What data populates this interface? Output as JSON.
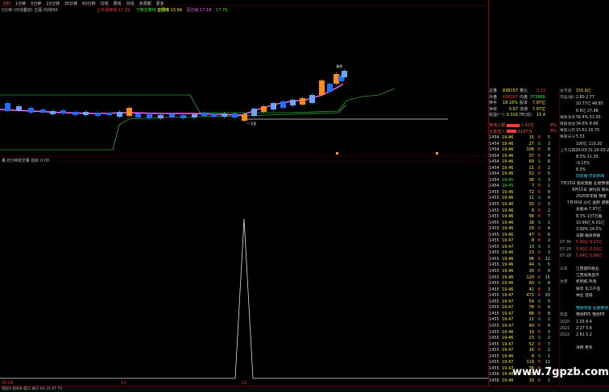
{
  "tabs": [
    "分时",
    "1分钟",
    "5分钟",
    "15分钟",
    "30分钟",
    "60分钟",
    "日线",
    "周线",
    "月线",
    "多周期",
    "更多"
  ],
  "legend_main": "5分钟 (日线叠加) 主图:均线MA",
  "legend_mid": [
    "上升涨停线 17.19",
    "下降支撑线 15.15"
  ],
  "legend_right": [
    "主要线 13.99",
    "压力线 17.18",
    "17.79"
  ],
  "sub_title": "量 8分钟成交量 指标 0.00",
  "price_labels": [
    "涨停",
    "一飞龙"
  ],
  "bottom_x_labels": [
    "01-08",
    "13",
    "12"
  ],
  "status_bar": "指标A 指标B 窗口 关口 KS 15 XT TV",
  "quote": {
    "rows": [
      {
        "l": "总量",
        "v": "838157",
        "vc": "",
        "l2": "量比",
        "v2": "2.13",
        "v2c": "red"
      },
      {
        "l": "外盘",
        "v": "436197",
        "vc": "red",
        "l2": "内盘",
        "v2": "373680",
        "v2c": "green"
      },
      {
        "l": "换手",
        "v": "18.16%",
        "vc": "",
        "l2": "股本",
        "v2": "7.97亿",
        "v2c": ""
      },
      {
        "l": "净资",
        "v": "5.67",
        "vc": "",
        "l2": "流通",
        "v2": "7.97亿",
        "v2c": ""
      },
      {
        "l": "收益(一)",
        "v": "0.316",
        "vc": "",
        "l2": "PE(动)",
        "v2": "15.4",
        "v2c": ""
      }
    ]
  },
  "flow": [
    {
      "l": "净流入额",
      "bar": 16,
      "v": "1.41亿",
      "p": "8%"
    },
    {
      "l": "大单流入",
      "bar": 12,
      "v": "6187万",
      "p": "8%"
    }
  ],
  "ticks": [
    {
      "t": "1454",
      "p": "19.46",
      "v": "15",
      "d": "B",
      "n": "5"
    },
    {
      "t": "1454",
      "p": "19.46",
      "v": "27",
      "d": "S",
      "n": "3"
    },
    {
      "t": "1454",
      "p": "19.46",
      "v": "106",
      "d": "B",
      "n": "8"
    },
    {
      "t": "1454",
      "p": "19.46",
      "v": "37",
      "d": "B",
      "n": "4"
    },
    {
      "t": "1454",
      "p": "19.46",
      "v": "69",
      "d": "S",
      "n": "6"
    },
    {
      "t": "1454",
      "p": "19.46",
      "v": "11",
      "d": "B",
      "n": "2"
    },
    {
      "t": "1454",
      "p": "19.46",
      "v": "52",
      "d": "B",
      "n": "5"
    },
    {
      "t": "1454",
      "p": "19.45",
      "v": "38",
      "d": "S",
      "n": "3"
    },
    {
      "t": "1454",
      "p": "19.45",
      "v": "7",
      "d": "B",
      "n": "1"
    },
    {
      "t": "1455",
      "p": "19.46",
      "v": "72",
      "d": "B",
      "n": "9"
    },
    {
      "t": "1455",
      "p": "19.46",
      "v": "11",
      "d": "S",
      "n": "4"
    },
    {
      "t": "1455",
      "p": "19.46",
      "v": "35",
      "d": "B",
      "n": "3"
    },
    {
      "t": "1455",
      "p": "19.46",
      "v": "6",
      "d": "B",
      "n": "2"
    },
    {
      "t": "1455",
      "p": "19.46",
      "v": "56",
      "d": "B",
      "n": "7"
    },
    {
      "t": "1455",
      "p": "19.46",
      "v": "18",
      "d": "S",
      "n": "1"
    },
    {
      "t": "1455",
      "p": "19.46",
      "v": "29",
      "d": "B",
      "n": "4"
    },
    {
      "t": "1455",
      "p": "19.46",
      "v": "47",
      "d": "B",
      "n": "6"
    },
    {
      "t": "1455",
      "p": "19.47",
      "v": "8",
      "d": "B",
      "n": "2"
    },
    {
      "t": "1455",
      "p": "19.47",
      "v": "13",
      "d": "S",
      "n": "1"
    },
    {
      "t": "1455",
      "p": "19.46",
      "v": "23",
      "d": "B",
      "n": "3"
    },
    {
      "t": "1455",
      "p": "19.46",
      "v": "96",
      "d": "B",
      "n": "12"
    },
    {
      "t": "1455",
      "p": "19.46",
      "v": "44",
      "d": "S",
      "n": "5"
    },
    {
      "t": "1455",
      "p": "19.46",
      "v": "30",
      "d": "B",
      "n": "4"
    },
    {
      "t": "1455",
      "p": "19.46",
      "v": "120",
      "d": "B",
      "n": "15"
    },
    {
      "t": "1455",
      "p": "19.46",
      "v": "60",
      "d": "S",
      "n": "6"
    },
    {
      "t": "1455",
      "p": "19.46",
      "v": "42",
      "d": "B",
      "n": "3"
    },
    {
      "t": "1455",
      "p": "19.47",
      "v": "471",
      "d": "B",
      "n": "20"
    },
    {
      "t": "1455",
      "p": "19.47",
      "v": "54",
      "d": "S",
      "n": "5"
    },
    {
      "t": "1455",
      "p": "19.47",
      "v": "78",
      "d": "B",
      "n": "6"
    },
    {
      "t": "1455",
      "p": "19.47",
      "v": "88",
      "d": "B",
      "n": "8"
    },
    {
      "t": "1455",
      "p": "19.47",
      "v": "11",
      "d": "S",
      "n": "2"
    },
    {
      "t": "1455",
      "p": "19.47",
      "v": "60",
      "d": "B",
      "n": "4"
    },
    {
      "t": "1455",
      "p": "19.46",
      "v": "19",
      "d": "B",
      "n": "3"
    },
    {
      "t": "1455",
      "p": "19.46",
      "v": "23",
      "d": "S",
      "n": "2"
    },
    {
      "t": "1455",
      "p": "19.47",
      "v": "52",
      "d": "B",
      "n": "7"
    },
    {
      "t": "1455",
      "p": "19.47",
      "v": "16",
      "d": "B",
      "n": "2"
    },
    {
      "t": "1455",
      "p": "19.46",
      "v": "8",
      "d": "S",
      "n": "1"
    },
    {
      "t": "1455",
      "p": "19.47",
      "v": "119",
      "d": "B",
      "n": "11"
    },
    {
      "t": "1455",
      "p": "19.47",
      "v": "38",
      "d": "B",
      "n": "5"
    },
    {
      "t": "1456",
      "p": "19.48",
      "v": "26",
      "d": "S",
      "n": "3"
    },
    {
      "t": "1456",
      "p": "19.48",
      "v": "10",
      "d": "B",
      "n": "2"
    }
  ],
  "ftable": [
    {
      "l": "总市值",
      "v": "155.0亿",
      "c": ""
    },
    {
      "l": "市盈(静)",
      "v": "2.80 2.77",
      "c": "w"
    },
    {
      "l": "",
      "v": "10.77亿 48.85",
      "c": "w"
    },
    {
      "l": "",
      "v": "6.6亿 27.68",
      "c": "w"
    },
    {
      "l": "每股净资",
      "v": "56.4% 51.00",
      "c": "w"
    },
    {
      "l": "每股收益",
      "v": "34.6% 8.68",
      "c": "w"
    },
    {
      "l": "每股公积",
      "v": "15.61 16.70",
      "c": "w"
    },
    {
      "l": "每股未分",
      "v": "5.53",
      "c": "w"
    },
    {
      "l": "",
      "v": "100亿 115.20",
      "c": "w"
    },
    {
      "l": "上市日期",
      "v": "20-03-31 20-03-28",
      "c": "w"
    },
    {
      "l": "",
      "v": "8.5% 21.35",
      "c": "w"
    },
    {
      "l": "",
      "v": "-9.15%",
      "c": "w"
    },
    {
      "l": "",
      "v": "8.0%",
      "c": "w"
    },
    {
      "l": "",
      "v": "同花顺 历史新闻",
      "c": "c"
    },
    {
      "l": "",
      "v": "7月15日 股权激励 业绩预增",
      "c": "w"
    },
    {
      "l": "",
      "v": "8月15日 净利润 增长",
      "c": "w"
    },
    {
      "l": "",
      "v": "2020年年报 预增",
      "c": "w"
    },
    {
      "l": "",
      "v": "7月30日 分红 送转 调整",
      "c": "w"
    },
    {
      "l": "",
      "v": "总股本 7.97亿",
      "c": "w"
    },
    {
      "l": "",
      "v": "8.3% 137万股",
      "c": "w"
    },
    {
      "l": "",
      "v": "10.99亿 6.01亿",
      "c": "w"
    },
    {
      "l": "",
      "v": "3.90% 14.5%",
      "c": "w"
    },
    {
      "l": "",
      "v": "日期 融资余额",
      "c": "w"
    },
    {
      "l": "07-30",
      "v": "5.60亿 6.17亿",
      "c": "r"
    },
    {
      "l": "07-29",
      "v": "5.60亿 6.01亿",
      "c": "r"
    },
    {
      "l": "07-28",
      "v": "5.64亿 5.90亿",
      "c": "r"
    },
    {
      "l": "",
      "v": "",
      "c": "w"
    },
    {
      "l": "公司",
      "v": "江西晨鸣纸业",
      "c": "w"
    },
    {
      "l": "",
      "v": "江西省南昌市",
      "c": "w"
    },
    {
      "l": "主营",
      "v": "机制纸 热电",
      "c": "w"
    },
    {
      "l": "",
      "v": "纸浆 化工产品",
      "c": "w"
    },
    {
      "l": "",
      "v": "林业 造纸",
      "c": "w"
    },
    {
      "l": "",
      "v": "",
      "c": "w"
    },
    {
      "l": "",
      "v": "预测评级 业绩预测",
      "c": "c"
    },
    {
      "l": "年度",
      "v": "预测EPS 预测PE",
      "c": "w"
    },
    {
      "l": "2020",
      "v": "1.03 6.4",
      "c": "w"
    },
    {
      "l": "2021",
      "v": "2.27 5.8",
      "c": "w"
    },
    {
      "l": "2022",
      "v": "2.61 5.2",
      "c": "w"
    },
    {
      "l": "",
      "v": "",
      "c": "w"
    },
    {
      "l": "",
      "v": "详情 更多",
      "c": "w"
    }
  ],
  "watermark": "www.7gpzb.com",
  "colors": {
    "up": "#ff4040",
    "down": "#3ce63c",
    "ma_pink": "#ff66ff",
    "line_green": "#3ce63c",
    "candle_blue": "#1f6fff",
    "candle_orange": "#ff8a1a"
  }
}
